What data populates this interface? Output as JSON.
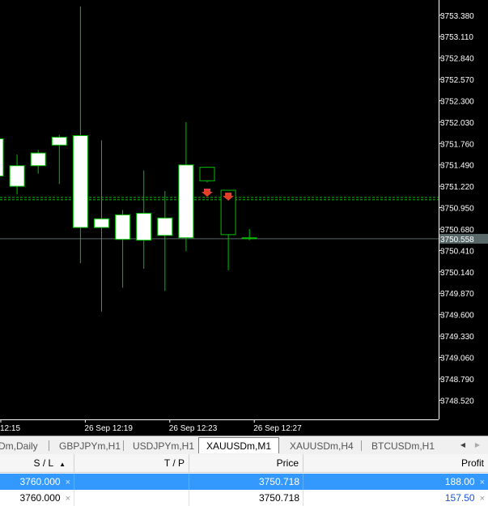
{
  "chart": {
    "symbol": "XAUUSDm",
    "timeframe": "M1",
    "colors": {
      "background": "#000000",
      "foreground": "#ffffff",
      "bull_body": "#ffffff",
      "bear_body": "#000000",
      "outline": "#00c000",
      "bid_line": "#5a6a6a",
      "level_line": "#00c000",
      "sell_arrow": "#e0402a"
    },
    "price_axis": {
      "min": 3748.36,
      "max": 3753.49,
      "ticks": [
        "3753.380",
        "3753.110",
        "3752.840",
        "3752.570",
        "3752.300",
        "3752.030",
        "3751.760",
        "3751.490",
        "3751.220",
        "3750.950",
        "3750.680",
        "3750.410",
        "3750.140",
        "3749.870",
        "3749.600",
        "3749.330",
        "3749.060",
        "3748.790",
        "3748.520"
      ],
      "current_price": "3750.558"
    },
    "time_axis": {
      "labels": [
        "12:15",
        "26 Sep 12:19",
        "26 Sep 12:23",
        "26 Sep 12:27"
      ],
      "label_bars": [
        0,
        4,
        8,
        12
      ]
    },
    "levels": [
      3751.08,
      3751.05
    ],
    "candles": [
      {
        "o": 3751.35,
        "h": 3751.85,
        "l": 3751.1,
        "c": 3751.82
      },
      {
        "o": 3751.22,
        "h": 3751.62,
        "l": 3751.12,
        "c": 3751.48
      },
      {
        "o": 3751.48,
        "h": 3751.68,
        "l": 3751.38,
        "c": 3751.64
      },
      {
        "o": 3751.74,
        "h": 3751.87,
        "l": 3751.25,
        "c": 3751.84
      },
      {
        "o": 3750.7,
        "h": 3753.49,
        "l": 3750.25,
        "c": 3751.86
      },
      {
        "o": 3750.7,
        "h": 3751.8,
        "l": 3749.64,
        "c": 3750.81
      },
      {
        "o": 3750.55,
        "h": 3750.92,
        "l": 3749.94,
        "c": 3750.86
      },
      {
        "o": 3750.54,
        "h": 3751.42,
        "l": 3750.18,
        "c": 3750.88
      },
      {
        "o": 3750.6,
        "h": 3751.16,
        "l": 3749.9,
        "c": 3750.82
      },
      {
        "o": 3750.57,
        "h": 3752.03,
        "l": 3750.4,
        "c": 3751.49
      },
      {
        "o": 3751.46,
        "h": 3751.46,
        "l": 3751.27,
        "c": 3751.29
      },
      {
        "o": 3751.17,
        "h": 3751.17,
        "l": 3750.16,
        "c": 3750.61
      },
      {
        "o": 3750.57,
        "h": 3750.68,
        "l": 3750.54,
        "c": 3750.56
      }
    ],
    "sell_arrows": [
      {
        "bar": 10,
        "price": 3751.15
      },
      {
        "bar": 11,
        "price": 3751.1
      }
    ]
  },
  "tabs": [
    {
      "label": "Dm,Daily",
      "active": false
    },
    {
      "label": "GBPJPYm,H1",
      "active": false
    },
    {
      "label": "USDJPYm,H1",
      "active": false
    },
    {
      "label": "XAUUSDm,M1",
      "active": true
    },
    {
      "label": "XAUUSDm,H4",
      "active": false
    },
    {
      "label": "BTCUSDm,H1",
      "active": false
    }
  ],
  "tab_scroll": {
    "left_icon": "◀",
    "right_icon": "▶"
  },
  "table": {
    "headers": {
      "sl": "S / L",
      "tp": "T / P",
      "price": "Price",
      "profit": "Profit"
    },
    "sort_icon": "▲",
    "close_icon": "×",
    "rows": [
      {
        "sl": "3760.000",
        "tp": "",
        "price": "3750.718",
        "profit": "188.00",
        "selected": true
      },
      {
        "sl": "3760.000",
        "tp": "",
        "price": "3750.718",
        "profit": "157.50",
        "selected": false
      }
    ]
  }
}
